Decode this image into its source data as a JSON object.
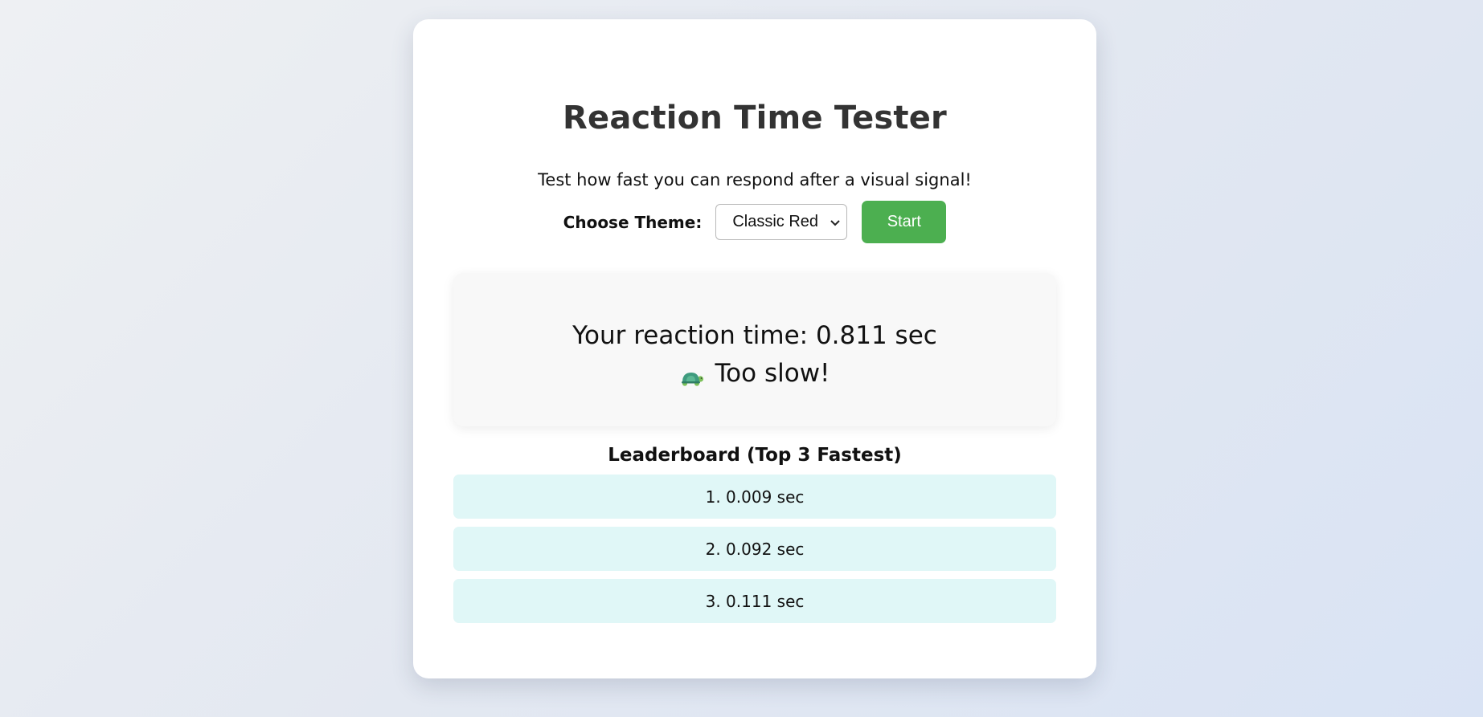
{
  "app": {
    "title": "Reaction Time Tester",
    "subtitle": "Test how fast you can respond after a visual signal!"
  },
  "controls": {
    "theme_label": "Choose Theme:",
    "theme_selected": "Classic Red",
    "start_label": "Start"
  },
  "result": {
    "reaction_text": "Your reaction time: 0.811 sec",
    "verdict_text": "Too slow!",
    "verdict_icon": "turtle-icon"
  },
  "leaderboard": {
    "title": "Leaderboard (Top 3 Fastest)",
    "entries": [
      "1. 0.009 sec",
      "2. 0.092 sec",
      "3. 0.111 sec"
    ]
  },
  "colors": {
    "start_button": "#4caf50",
    "leaderboard_row": "#e0f7f7",
    "title_text": "#333333"
  }
}
